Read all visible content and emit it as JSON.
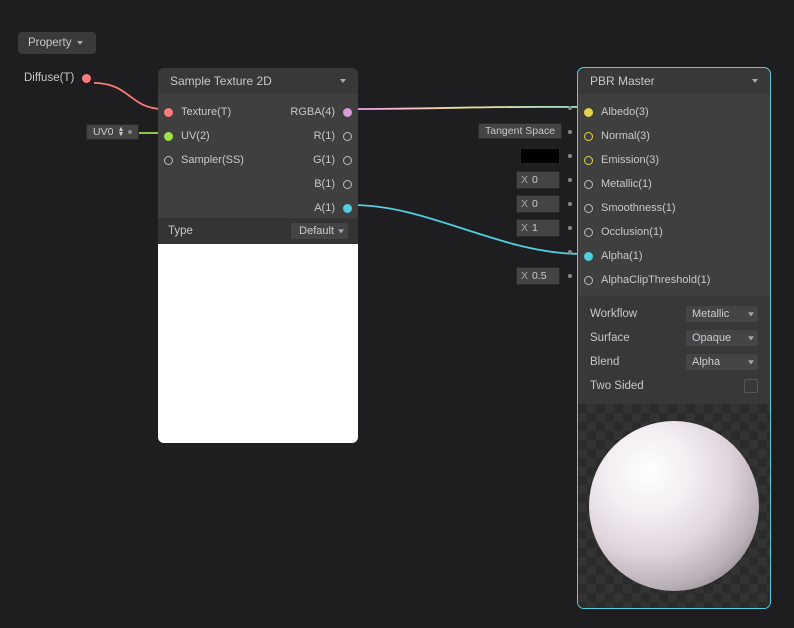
{
  "blackboard": {
    "title": "Property",
    "items": [
      {
        "label": "Diffuse(T)",
        "port_color": "#ff7a7a"
      }
    ]
  },
  "external_inputs": {
    "uv_label": "UV0"
  },
  "sample_node": {
    "title": "Sample Texture 2D",
    "inputs": [
      {
        "label": "Texture(T)",
        "color": "#ff7a7a",
        "connected": true
      },
      {
        "label": "UV(2)",
        "color": "#9fe24a",
        "connected": true
      },
      {
        "label": "Sampler(SS)",
        "color": "#bbbbbb",
        "connected": false
      }
    ],
    "outputs": [
      {
        "label": "RGBA(4)",
        "color": "#4fd0e0",
        "connected": true
      },
      {
        "label": "R(1)",
        "color": "#bbbbbb",
        "connected": false
      },
      {
        "label": "G(1)",
        "color": "#bbbbbb",
        "connected": false
      },
      {
        "label": "B(1)",
        "color": "#bbbbbb",
        "connected": false
      },
      {
        "label": "A(1)",
        "color": "#4fd0e0",
        "connected": true
      }
    ],
    "footer_label": "Type",
    "footer_value": "Default"
  },
  "pbr_node": {
    "title": "PBR Master",
    "inputs": [
      {
        "label": "Albedo(3)",
        "widget": null,
        "connected": true,
        "port_color": "#e4d24a"
      },
      {
        "label": "Normal(3)",
        "widget": "tangent",
        "connected": false,
        "port_color": "#e4d24a"
      },
      {
        "label": "Emission(3)",
        "widget": "color",
        "connected": false,
        "port_color": "#e4d24a"
      },
      {
        "label": "Metallic(1)",
        "widget": "x",
        "value": "0",
        "connected": false
      },
      {
        "label": "Smoothness(1)",
        "widget": "x",
        "value": "0",
        "connected": false
      },
      {
        "label": "Occlusion(1)",
        "widget": "x",
        "value": "1",
        "connected": false
      },
      {
        "label": "Alpha(1)",
        "widget": null,
        "connected": true,
        "port_color": "#4fd0e0"
      },
      {
        "label": "AlphaClipThreshold(1)",
        "widget": "x",
        "value": "0.5",
        "connected": false
      }
    ],
    "tangent_space_label": "Tangent Space",
    "x_prefix": "X",
    "settings": [
      {
        "label": "Workflow",
        "value": "Metallic",
        "kind": "select"
      },
      {
        "label": "Surface",
        "value": "Opaque",
        "kind": "select"
      },
      {
        "label": "Blend",
        "value": "Alpha",
        "kind": "select"
      },
      {
        "label": "Two Sided",
        "value": false,
        "kind": "checkbox"
      }
    ]
  }
}
